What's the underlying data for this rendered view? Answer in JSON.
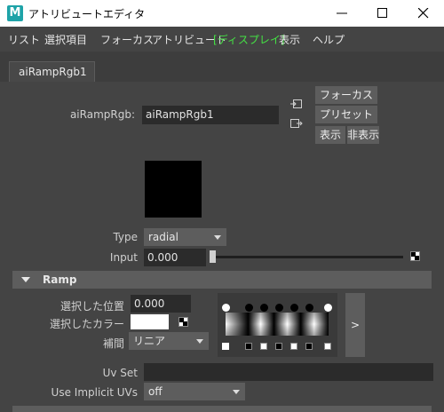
{
  "window": {
    "title": "アトリビュートエディタ",
    "app_icon_letter": "M"
  },
  "menu": [
    "リスト",
    "選択項目",
    "フォーカス",
    "アトリビュート",
    "[ディスプレイ]",
    "表示",
    "ヘルプ"
  ],
  "tab": {
    "label": "aiRampRgb1"
  },
  "node": {
    "label": "aiRampRgb:",
    "value": "aiRampRgb1"
  },
  "buttons": {
    "focus": "フォーカス",
    "preset": "プリセット",
    "show": "表示",
    "hide": "非表示"
  },
  "type": {
    "label": "Type",
    "value": "radial"
  },
  "input": {
    "label": "Input",
    "value": "0.000",
    "slider_fraction": 0.0
  },
  "ramp": {
    "header": "Ramp",
    "selected_position_label": "選択した位置",
    "selected_position_value": "0.000",
    "selected_color_label": "選択したカラー",
    "selected_color": "#ffffff",
    "interpolation_label": "補間",
    "interpolation_value": "リニア",
    "expand_label": ">"
  },
  "uvset": {
    "label": "Uv Set",
    "value": ""
  },
  "implicit": {
    "label": "Use Implicit UVs",
    "value": "off"
  },
  "colors": {
    "accent_green": "#44e244",
    "bg": "#444444",
    "field_bg": "#2b2b2b"
  }
}
